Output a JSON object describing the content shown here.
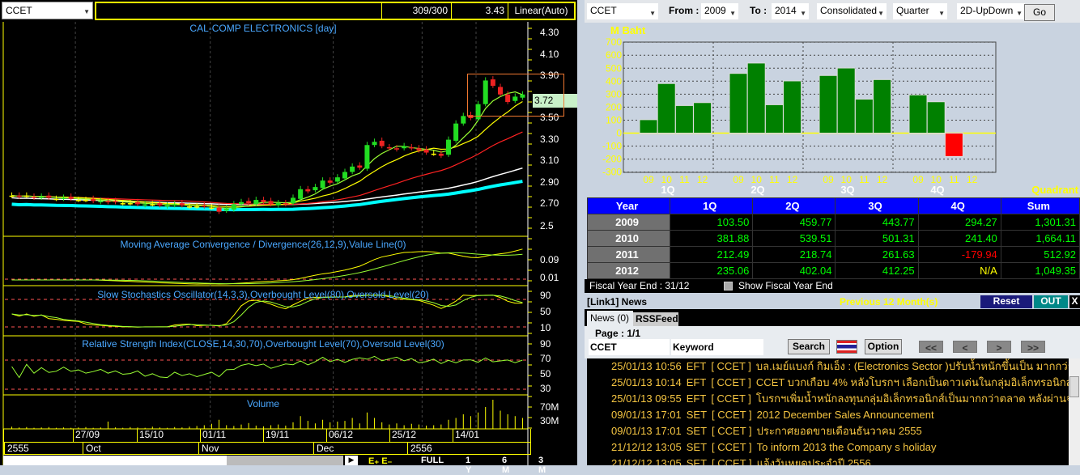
{
  "left": {
    "symbol": "CCET",
    "count": "309/300",
    "value": "3.43",
    "scale": "Linear(Auto)",
    "title": "CAL-COMP ELECTRONICS [day]",
    "price_badge": "3.72",
    "price_ticks": [
      "4.30",
      "4.10",
      "3.90",
      "3.50",
      "3.30",
      "3.10",
      "2.90",
      "2.70",
      "2.5"
    ],
    "macd_title": "Moving Average Convergence / Divergence(26,12,9),Value Line(0)",
    "macd_ticks": [
      "0.09",
      "0.01"
    ],
    "stoch_title": "Slow Stochastics Oscillator(14,3,3),Overbought Level(80),Oversold Level(20)",
    "stoch_ticks": [
      "90",
      "50",
      "10"
    ],
    "rsi_title": "Relative Strength Index(CLOSE,14,30,70),Overbought Level(70),Oversold Level(30)",
    "rsi_ticks": [
      "90",
      "70",
      "50",
      "30"
    ],
    "volume_title": "Volume",
    "volume_ticks": [
      "70M",
      "30M"
    ],
    "dates": [
      "27/09",
      "15/10",
      "01/11",
      "19/11",
      "06/12",
      "25/12",
      "14/01"
    ],
    "months": [
      "2555",
      "Oct",
      "Nov",
      "Dec",
      "2556"
    ],
    "range_buttons": [
      "FULL",
      "1 Y",
      "6 M",
      "3 M"
    ],
    "closes": [
      2.78,
      2.77,
      2.78,
      2.76,
      2.77,
      2.76,
      2.75,
      2.76,
      2.75,
      2.74,
      2.74,
      2.73,
      2.73,
      2.72,
      2.72,
      2.71,
      2.71,
      2.7,
      2.7,
      2.7,
      2.69,
      2.69,
      2.7,
      2.69,
      2.68,
      2.68,
      2.68,
      2.67,
      2.63,
      2.66,
      2.7,
      2.72,
      2.71,
      2.74,
      2.72,
      2.7,
      2.71,
      2.7,
      2.76,
      2.84,
      2.82,
      2.86,
      2.92,
      2.9,
      2.95,
      3.0,
      3.05,
      3.04,
      3.25,
      3.28,
      3.24,
      3.22,
      3.21,
      3.24,
      3.22,
      3.2,
      3.18,
      3.17,
      3.15,
      3.3,
      3.45,
      3.52,
      3.5,
      3.63,
      3.85,
      3.8,
      3.72,
      3.65,
      3.7,
      3.72
    ],
    "volumes_m": [
      6,
      4,
      5,
      3,
      4,
      5,
      3,
      4,
      3,
      4,
      5,
      3,
      4,
      20,
      4,
      3,
      5,
      4,
      3,
      6,
      4,
      3,
      5,
      4,
      6,
      8,
      10,
      14,
      25,
      10,
      8,
      12,
      16,
      9,
      7,
      10,
      12,
      9,
      18,
      35,
      22,
      15,
      25,
      18,
      20,
      22,
      30,
      15,
      45,
      30,
      18,
      12,
      15,
      10,
      14,
      12,
      9,
      10,
      12,
      25,
      30,
      40,
      35,
      45,
      60,
      80,
      50,
      40,
      35,
      30
    ]
  },
  "right": {
    "symbol": "CCET",
    "from_label": "From :",
    "from": "2009",
    "to_label": "To :",
    "to": "2014",
    "statement": "Consolidated",
    "period": "Quarter",
    "chart_mode": "2D-UpDown",
    "go": "Go",
    "chart_data": {
      "type": "bar",
      "ylabel": "M Baht",
      "xlabel": "Quadrant",
      "ylim": [
        -300,
        700
      ],
      "yticks": [
        "700",
        "600",
        "500",
        "400",
        "300",
        "200",
        "100",
        "0",
        "-100",
        "-200",
        "-300"
      ],
      "groups": [
        "1Q",
        "2Q",
        "3Q",
        "4Q"
      ],
      "years": [
        "09",
        "10",
        "11",
        "12"
      ],
      "series": [
        {
          "group": "1Q",
          "values": [
            103.5,
            381.88,
            212.49,
            235.06
          ]
        },
        {
          "group": "2Q",
          "values": [
            459.77,
            539.51,
            218.74,
            402.04
          ]
        },
        {
          "group": "3Q",
          "values": [
            443.77,
            501.31,
            261.63,
            412.25
          ]
        },
        {
          "group": "4Q",
          "values": [
            294.27,
            241.4,
            -179.94,
            null
          ]
        }
      ],
      "pos_color": "#008000",
      "neg_color": "#ff0000"
    },
    "table": {
      "headers": [
        "Year",
        "1Q",
        "2Q",
        "3Q",
        "4Q",
        "Sum"
      ],
      "rows": [
        [
          "2009",
          "103.50",
          "459.77",
          "443.77",
          "294.27",
          "1,301.31"
        ],
        [
          "2010",
          "381.88",
          "539.51",
          "501.31",
          "241.40",
          "1,664.11"
        ],
        [
          "2011",
          "212.49",
          "218.74",
          "261.63",
          "-179.94",
          "512.92"
        ],
        [
          "2012",
          "235.06",
          "402.04",
          "412.25",
          "N/A",
          "1,049.35"
        ]
      ]
    },
    "fiscal_label": "Fiscal  Year  End  :  31/12",
    "show_fiscal": "Show Fiscal Year End",
    "news": {
      "title": "[Link1] News",
      "period": "Previous 12 Month(s)",
      "reset": "Reset",
      "out": "OUT",
      "close": "X",
      "tabs": [
        "News (0)",
        "RSSFeeds"
      ],
      "page": "Page : 1/1",
      "symbol": "CCET",
      "keyword": "Keyword",
      "search": "Search",
      "option": "Option",
      "nav": [
        "<<",
        "<",
        ">",
        ">>"
      ],
      "items": [
        [
          "25/01/13 10:56",
          "EFT",
          "[ CCET ]",
          "บล.เมย์แบงก์ กิมเอ็ง : (Electronics Sector )ปรับน้ำหนักขึ้นเป็น มากกว่าตลา..."
        ],
        [
          "25/01/13 10:14",
          "EFT",
          "[ CCET ]",
          "CCET บวกเกือบ 4% หลังโบรกฯ เลือกเป็นดาวเด่นในกลุ่มอิเล็กทรอนิกส์"
        ],
        [
          "25/01/13 09:55",
          "EFT",
          "[ CCET ]",
          "โบรกฯเพิ่มน้ำหนักลงทุนกลุ่มอิเล็กทรอนิกส์เป็นมากกว่าตลาด หลังผ่านจุดต่ำสุดไ..."
        ],
        [
          "09/01/13 17:01",
          "SET",
          "[ CCET ]",
          "2012 December Sales Announcement"
        ],
        [
          "09/01/13 17:01",
          "SET",
          "[ CCET ]",
          "ประกาศยอดขายเดือนธันวาคม 2555"
        ],
        [
          "21/12/12 13:05",
          "SET",
          "[ CCET ]",
          "To inform 2013 the Company s holiday"
        ],
        [
          "21/12/12 13:05",
          "SET",
          "[ CCET ]",
          "แจ้งวันหยุดประจำปี 2556"
        ]
      ]
    }
  }
}
